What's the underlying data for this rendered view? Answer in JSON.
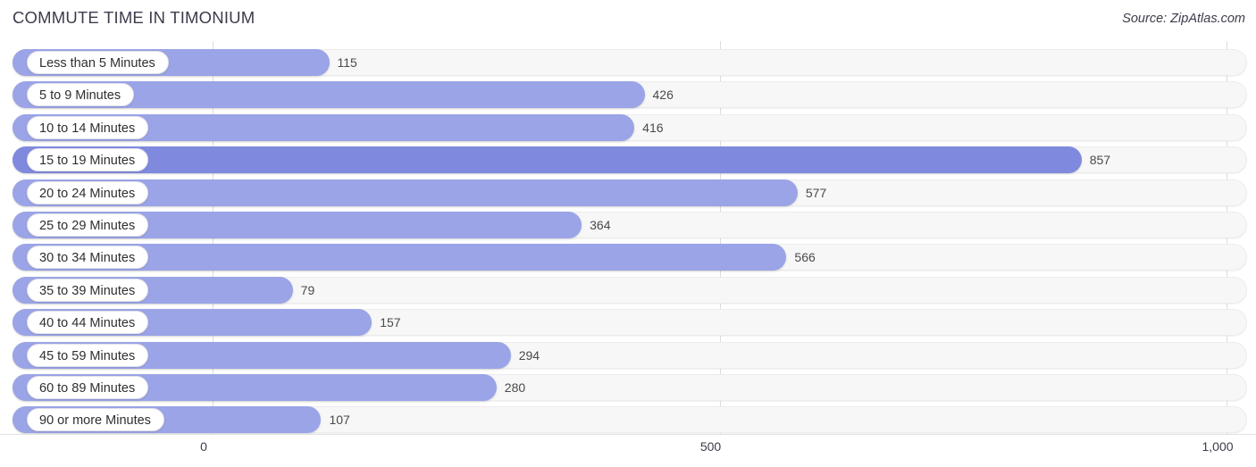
{
  "header": {
    "title": "COMMUTE TIME IN TIMONIUM",
    "source": "Source: ZipAtlas.com"
  },
  "axis": {
    "ticks": [
      {
        "label": "0",
        "value": 0
      },
      {
        "label": "500",
        "value": 500
      },
      {
        "label": "1,000",
        "value": 1000
      }
    ]
  },
  "colors": {
    "bar": "#9aa4e6",
    "bar_highlight": "#7f8ade",
    "track": "#f7f7f7",
    "gridline": "#dcdcdc",
    "text": "#3c3c4c",
    "value_inside": "#ffffff"
  },
  "chart_data": {
    "type": "bar",
    "orientation": "horizontal",
    "title": "COMMUTE TIME IN TIMONIUM",
    "xlabel": "",
    "ylabel": "",
    "xlim": [
      0,
      1000
    ],
    "grid": true,
    "legend": "none",
    "categories": [
      "Less than 5 Minutes",
      "5 to 9 Minutes",
      "10 to 14 Minutes",
      "15 to 19 Minutes",
      "20 to 24 Minutes",
      "25 to 29 Minutes",
      "30 to 34 Minutes",
      "35 to 39 Minutes",
      "40 to 44 Minutes",
      "45 to 59 Minutes",
      "60 to 89 Minutes",
      "90 or more Minutes"
    ],
    "values": [
      115,
      426,
      416,
      857,
      577,
      364,
      566,
      79,
      157,
      294,
      280,
      107
    ],
    "value_labels": [
      "115",
      "426",
      "416",
      "857",
      "577",
      "364",
      "566",
      "79",
      "157",
      "294",
      "280",
      "107"
    ],
    "highlight_index": 3,
    "tick_labels": [
      "0",
      "500",
      "1,000"
    ],
    "tick_values": [
      0,
      500,
      1000
    ]
  }
}
